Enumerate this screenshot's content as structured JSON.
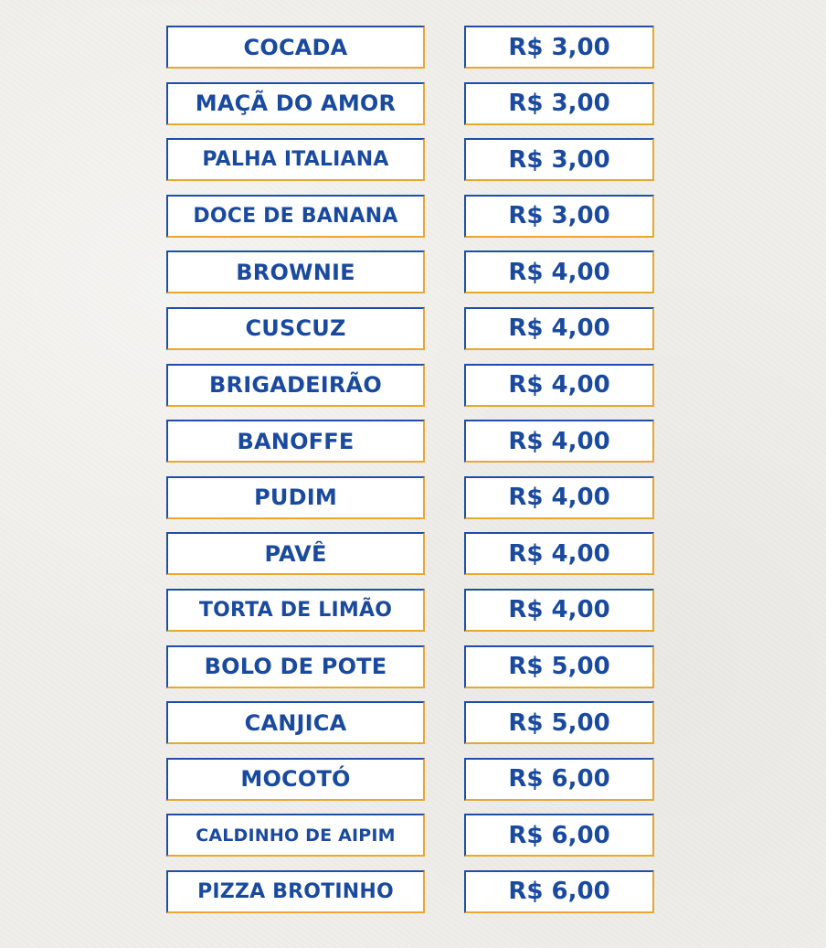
{
  "menu": {
    "items": [
      {
        "name": "COCADA",
        "price": "R$ 3,00"
      },
      {
        "name": "MAÇÃ DO AMOR",
        "price": "R$ 3,00"
      },
      {
        "name": "PALHA ITALIANA",
        "price": "R$ 3,00"
      },
      {
        "name": "DOCE DE BANANA",
        "price": "R$ 3,00"
      },
      {
        "name": "BROWNIE",
        "price": "R$ 4,00"
      },
      {
        "name": "CUSCUZ",
        "price": "R$ 4,00"
      },
      {
        "name": "BRIGADEIRÃO",
        "price": "R$ 4,00"
      },
      {
        "name": "BANOFFE",
        "price": "R$ 4,00"
      },
      {
        "name": "PUDIM",
        "price": "R$ 4,00"
      },
      {
        "name": "PAVÊ",
        "price": "R$ 4,00"
      },
      {
        "name": "TORTA DE LIMÃO",
        "price": "R$ 4,00"
      },
      {
        "name": "BOLO DE POTE",
        "price": "R$ 5,00"
      },
      {
        "name": "CANJICA",
        "price": "R$ 5,00"
      },
      {
        "name": "MOCOTÓ",
        "price": "R$ 6,00"
      },
      {
        "name": "CALDINHO DE AIPIM",
        "price": "R$ 6,00"
      },
      {
        "name": "PIZZA BROTINHO",
        "price": "R$ 6,00"
      }
    ]
  },
  "colors": {
    "text": "#1a4a9e",
    "border_blue": "#1f4ea6",
    "border_gold": "#e9a72f",
    "background": "#efeeea"
  }
}
